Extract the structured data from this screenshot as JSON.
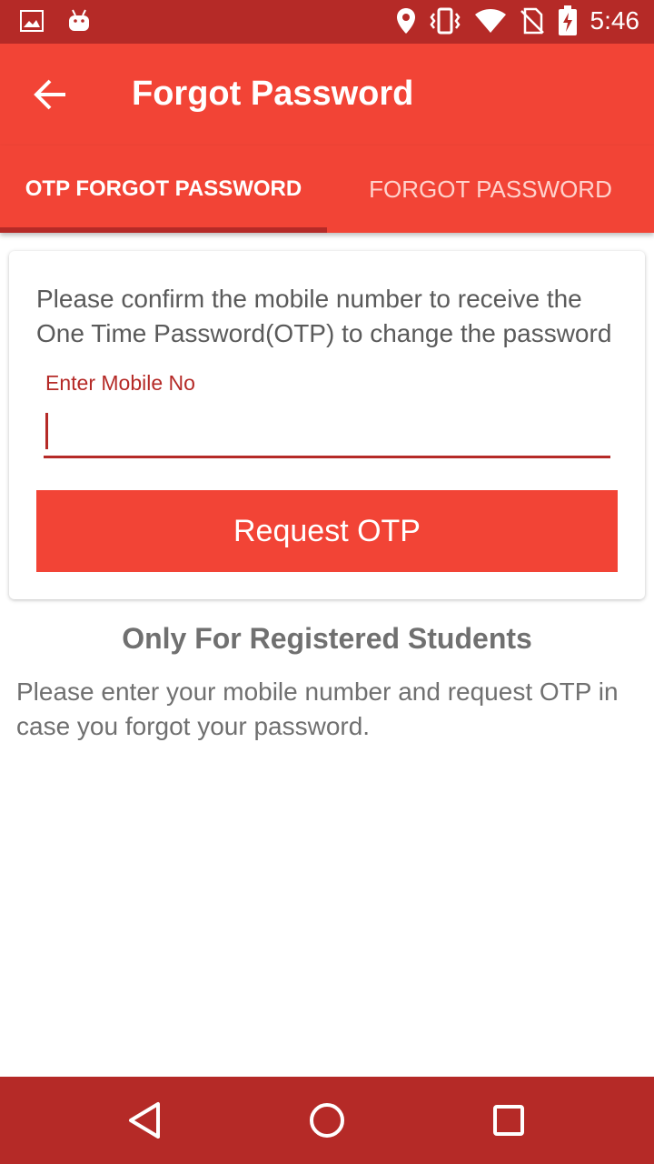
{
  "status_bar": {
    "time": "5:46",
    "icons": [
      "image-icon",
      "android-icon",
      "location-icon",
      "vibrate-icon",
      "wifi-icon",
      "no-sim-icon",
      "battery-charging-icon"
    ]
  },
  "app_bar": {
    "title": "Forgot Password",
    "back_icon": "arrow-back-icon"
  },
  "tabs": [
    {
      "label": "OTP FORGOT PASSWORD",
      "selected": true
    },
    {
      "label": "FORGOT PASSWORD",
      "selected": false
    }
  ],
  "card": {
    "message": "Please confirm the mobile number to receive the One Time Password(OTP) to change the password",
    "input_label": "Enter Mobile No",
    "input_value": "",
    "button_label": "Request OTP"
  },
  "info": {
    "title": "Only For Registered Students",
    "text": "Please enter your mobile number and request OTP in case you forgot your password."
  },
  "colors": {
    "primary": "#f24436",
    "primary_dark": "#b52a27",
    "text_gray": "#707070"
  },
  "nav_bar": {
    "icons": [
      "nav-back-icon",
      "nav-home-icon",
      "nav-recent-icon"
    ]
  }
}
